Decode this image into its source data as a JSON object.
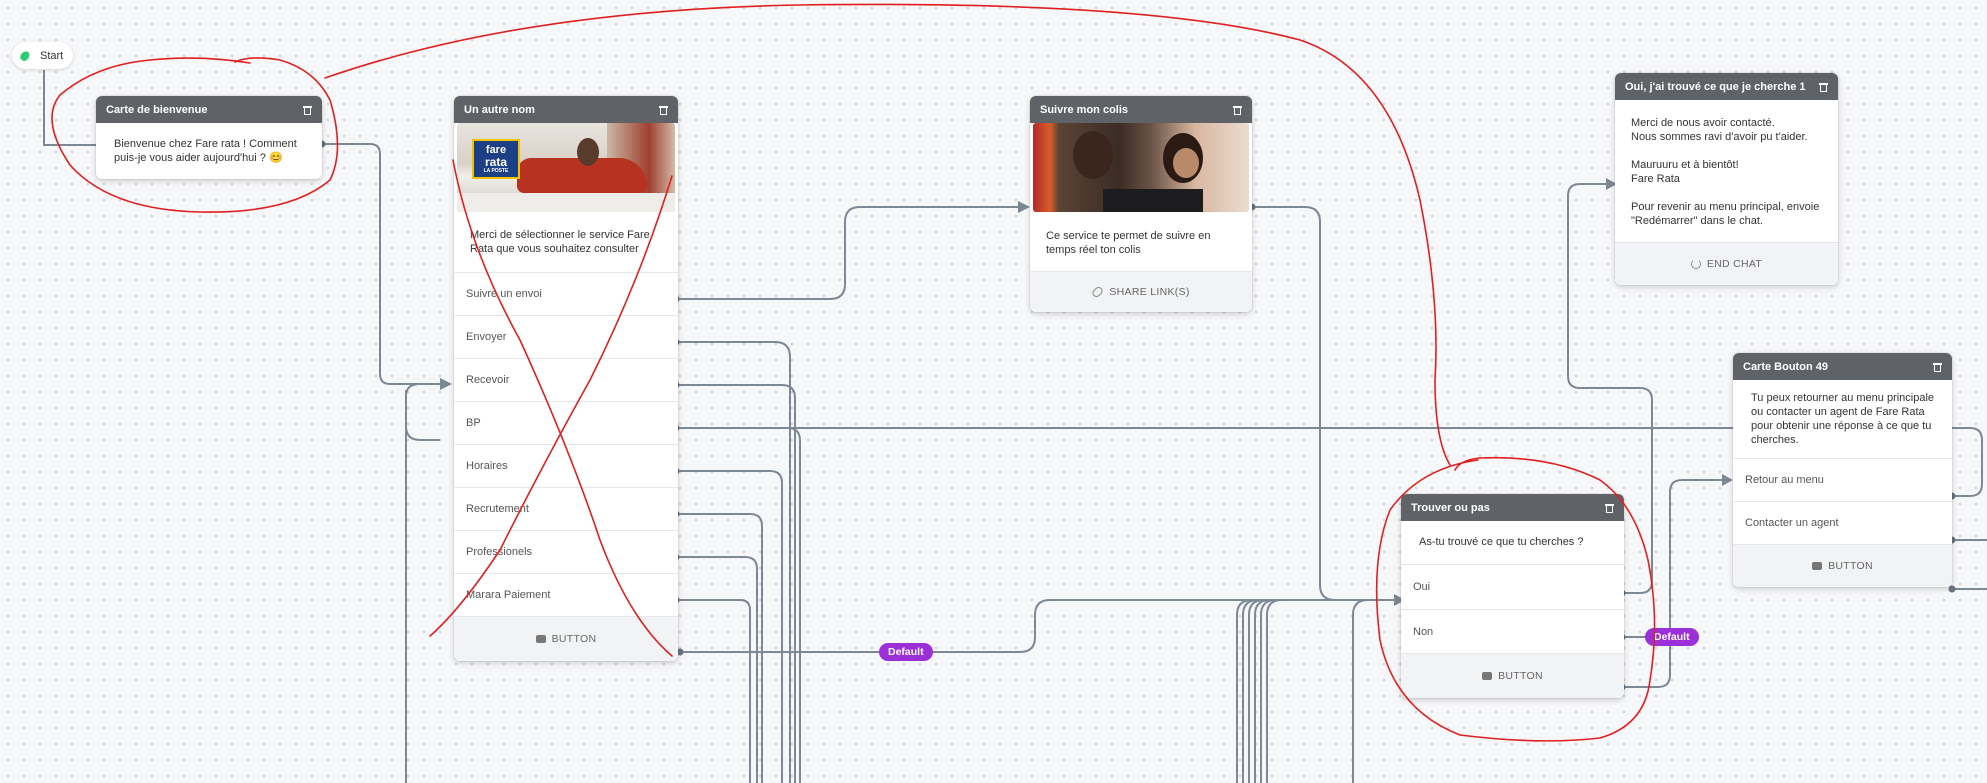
{
  "start": {
    "label": "Start"
  },
  "cards": {
    "bienvenue": {
      "title": "Carte de bienvenue",
      "message": "Bienvenue chez Fare rata ! Comment puis-je vous aider aujourd'hui ? 😊"
    },
    "autre_nom": {
      "title": "Un autre nom",
      "image_logo": {
        "line1": "fare",
        "line2": "rata",
        "line3": "LA POSTE"
      },
      "message": "Merci de sélectionner le service Fare Rata que vous souhaitez consulter",
      "options": [
        "Suivre un envoi",
        "Envoyer",
        "Recevoir",
        "BP",
        "Horaires",
        "Recrutement",
        "Professionels",
        "Marara Paiement"
      ],
      "footer": "BUTTON"
    },
    "suivre": {
      "title": "Suivre mon colis",
      "message": "Ce service te permet de suivre en temps réel ton colis",
      "footer": "SHARE LINK(S)"
    },
    "oui": {
      "title": "Oui, j'ai trouvé ce que je cherche 1",
      "message": "Merci de nous avoir contacté.\nNous sommes ravi d'avoir pu t'aider.\n\nMauruuru et à bientôt!\nFare Rata\n\nPour revenir au menu principal, envoie \"Redémarrer\" dans le chat.",
      "footer": "END CHAT"
    },
    "bouton49": {
      "title": "Carte Bouton 49",
      "message": "Tu peux retourner au menu principale ou contacter un agent de Fare Rata pour obtenir une réponse à ce que tu cherches.",
      "options": [
        "Retour au menu",
        "Contacter un agent"
      ],
      "footer": "BUTTON"
    },
    "trouver": {
      "title": "Trouver ou pas",
      "message": "As-tu trouvé ce que tu cherches ?",
      "options": [
        "Oui",
        "Non"
      ],
      "footer": "BUTTON"
    }
  },
  "badges": {
    "default1": "Default",
    "default2": "Default"
  },
  "colors": {
    "header": "#5f6368",
    "wire": "#7b8794",
    "badge": "#9b30d9",
    "annotation": "#e02020"
  }
}
